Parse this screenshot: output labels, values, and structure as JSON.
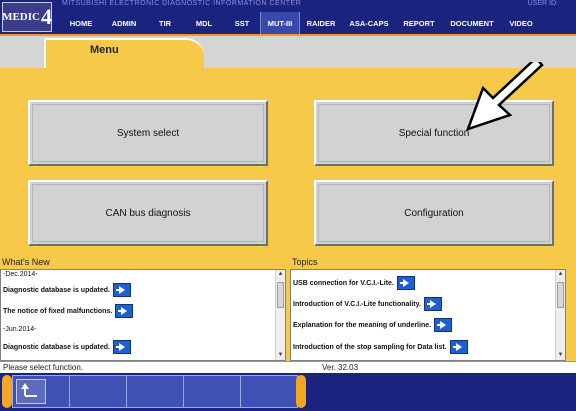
{
  "header": {
    "center_name": "MITSUBISHI ELECTRONIC DIAGNOSTIC INFORMATION CENTER",
    "user_id": "USER ID: ",
    "logo_text": "MEDIC",
    "logo_number": "4"
  },
  "nav": {
    "tabs": [
      {
        "label": "HOME",
        "active": false
      },
      {
        "label": "ADMIN",
        "active": false
      },
      {
        "label": "TIR",
        "active": false
      },
      {
        "label": "MDL",
        "active": false
      },
      {
        "label": "SST",
        "active": false
      },
      {
        "label": "MUT-III",
        "active": true
      },
      {
        "label": "RAIDER",
        "active": false
      },
      {
        "label": "ASA-CAPS",
        "active": false
      },
      {
        "label": "REPORT",
        "active": false
      },
      {
        "label": "DOCUMENT",
        "active": false
      },
      {
        "label": "VIDEO",
        "active": false
      }
    ]
  },
  "menu": {
    "title": "Menu",
    "buttons": [
      {
        "label": "System select"
      },
      {
        "label": "Special function"
      },
      {
        "label": "CAN bus diagnosis"
      },
      {
        "label": "Configuration"
      }
    ]
  },
  "whats_new": {
    "title": "What's New",
    "items": [
      {
        "text": "-Dec.2014-",
        "type": "date"
      },
      {
        "text": "Diagnostic database is updated.",
        "type": "link"
      },
      {
        "text": "The notice of fixed malfunctions.",
        "type": "link"
      },
      {
        "text": "-Jun.2014-",
        "type": "date"
      },
      {
        "text": "Diagnostic database is updated.",
        "type": "link"
      }
    ]
  },
  "topics": {
    "title": "Topics",
    "items": [
      {
        "text": "USB connection for V.C.I.-Lite."
      },
      {
        "text": "Introduction of V.C.I.-Lite functionality."
      },
      {
        "text": "Explanation for the meaning of underline."
      },
      {
        "text": "Introduction of the stop sampling for Data list."
      }
    ]
  },
  "status": {
    "message": "Please select function.",
    "version": "Ver. 32.03"
  },
  "colors": {
    "nav_bg": "#1a237e",
    "panel_yellow": "#f7c948",
    "accent_orange": "#f39c12",
    "link_button": "#1f5fd1"
  },
  "icons": {
    "callout": "arrow-pointer-icon",
    "home": "return-home-icon",
    "go": "blue-arrow-icon"
  }
}
